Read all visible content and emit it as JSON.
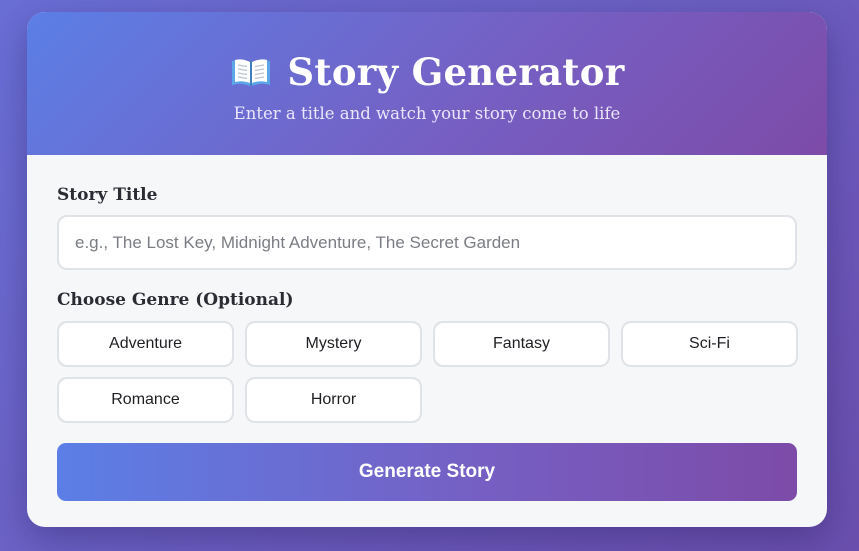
{
  "header": {
    "icon": "open-book-icon",
    "title": "Story Generator",
    "subtitle": "Enter a title and watch your story come to life"
  },
  "form": {
    "title_label": "Story Title",
    "title_value": "",
    "title_placeholder": "e.g., The Lost Key, Midnight Adventure, The Secret Garden",
    "genre_label": "Choose Genre (Optional)",
    "genres": [
      "Adventure",
      "Mystery",
      "Fantasy",
      "Sci-Fi",
      "Romance",
      "Horror"
    ],
    "submit_label": "Generate Story"
  },
  "colors": {
    "gradient_start": "#5b7fe6",
    "gradient_mid": "#7560c4",
    "gradient_end": "#7d4ba8",
    "card_bg": "#f6f7f9",
    "border": "#dfe2e6"
  }
}
